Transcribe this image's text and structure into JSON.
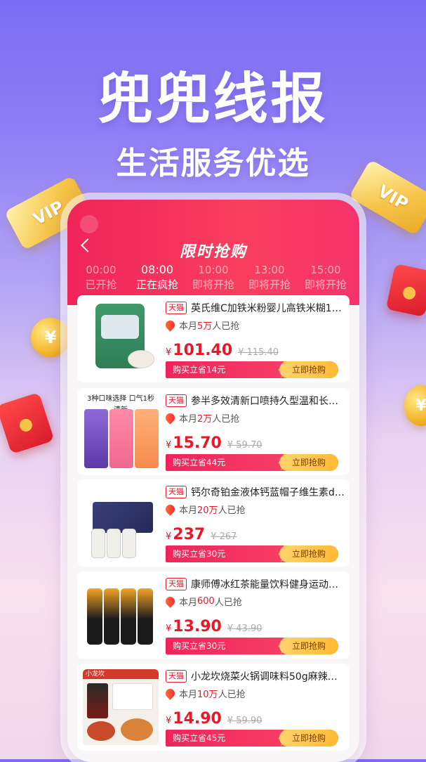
{
  "hero": {
    "title": "兜兜线报",
    "subtitle": "生活服务优选"
  },
  "decor": {
    "vip_label": "VIP",
    "coin_symbol": "¥"
  },
  "header": {
    "title": "限时抢购",
    "tabs": [
      {
        "time": "00:00",
        "status": "已开抢",
        "active": false
      },
      {
        "time": "08:00",
        "status": "正在疯抢",
        "active": true
      },
      {
        "time": "10:00",
        "status": "即将开抢",
        "active": false
      },
      {
        "time": "13:00",
        "status": "即将开抢",
        "active": false
      },
      {
        "time": "15:00",
        "status": "即将开抢",
        "active": false
      }
    ]
  },
  "products": [
    {
      "badge": "天猫",
      "name": "英氏维C加铁米粉婴儿高铁米糊1阶...",
      "sold_prefix": "本月",
      "sold_count": "5万",
      "sold_suffix": "人已抢",
      "yen": "¥",
      "price": "101.40",
      "original_price": "¥ 115.40",
      "save_text": "购买立省14元",
      "button": "立即抢购"
    },
    {
      "badge": "天猫",
      "name": "参半多效清新口喷持久型温和长效...",
      "sold_prefix": "本月",
      "sold_count": "2万",
      "sold_suffix": "人已抢",
      "yen": "¥",
      "price": "15.70",
      "original_price": "¥ 59.70",
      "save_text": "购买立省44元",
      "button": "立即抢购",
      "thumb_label": "3种口味选择 口气1秒 清新"
    },
    {
      "badge": "天猫",
      "name": "钙尔奇铂金液体钙蓝帽子维生素d3...",
      "sold_prefix": "本月",
      "sold_count": "20万",
      "sold_suffix": "人已抢",
      "yen": "¥",
      "price": "237",
      "original_price": "¥ 267",
      "save_text": "购买立省30元",
      "button": "立即抢购"
    },
    {
      "badge": "天猫",
      "name": "康师傅冰红茶能量饮料健身运动饮...",
      "sold_prefix": "本月",
      "sold_count": "600",
      "sold_suffix": "人已抢",
      "yen": "¥",
      "price": "13.90",
      "original_price": "¥ 43.90",
      "save_text": "购买立省30元",
      "button": "立即抢购"
    },
    {
      "badge": "天猫",
      "name": "小龙坎烧菜火锅调味料50g麻辣香锅...",
      "sold_prefix": "本月",
      "sold_count": "10万",
      "sold_suffix": "人已抢",
      "yen": "¥",
      "price": "14.90",
      "original_price": "¥ 59.90",
      "save_text": "购买立省45元",
      "button": "立即抢购",
      "thumb_label": "小龙坎"
    }
  ]
}
